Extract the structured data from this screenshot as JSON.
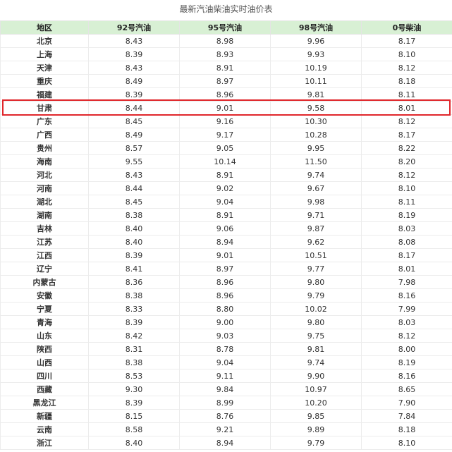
{
  "title": "最新汽油柴油实时油价表",
  "table": {
    "headers": [
      "地区",
      "92号汽油",
      "95号汽油",
      "98号汽油",
      "0号柴油"
    ],
    "highlighted_row": "甘肃",
    "rows": [
      [
        "北京",
        "8.43",
        "8.98",
        "9.96",
        "8.17"
      ],
      [
        "上海",
        "8.39",
        "8.93",
        "9.93",
        "8.10"
      ],
      [
        "天津",
        "8.43",
        "8.91",
        "10.19",
        "8.12"
      ],
      [
        "重庆",
        "8.49",
        "8.97",
        "10.11",
        "8.18"
      ],
      [
        "福建",
        "8.39",
        "8.96",
        "9.81",
        "8.11"
      ],
      [
        "甘肃",
        "8.44",
        "9.01",
        "9.58",
        "8.01"
      ],
      [
        "广东",
        "8.45",
        "9.16",
        "10.30",
        "8.12"
      ],
      [
        "广西",
        "8.49",
        "9.17",
        "10.28",
        "8.17"
      ],
      [
        "贵州",
        "8.57",
        "9.05",
        "9.95",
        "8.22"
      ],
      [
        "海南",
        "9.55",
        "10.14",
        "11.50",
        "8.20"
      ],
      [
        "河北",
        "8.43",
        "8.91",
        "9.74",
        "8.12"
      ],
      [
        "河南",
        "8.44",
        "9.02",
        "9.67",
        "8.10"
      ],
      [
        "湖北",
        "8.45",
        "9.04",
        "9.98",
        "8.11"
      ],
      [
        "湖南",
        "8.38",
        "8.91",
        "9.71",
        "8.19"
      ],
      [
        "吉林",
        "8.40",
        "9.06",
        "9.87",
        "8.03"
      ],
      [
        "江苏",
        "8.40",
        "8.94",
        "9.62",
        "8.08"
      ],
      [
        "江西",
        "8.39",
        "9.01",
        "10.51",
        "8.17"
      ],
      [
        "辽宁",
        "8.41",
        "8.97",
        "9.77",
        "8.01"
      ],
      [
        "内蒙古",
        "8.36",
        "8.96",
        "9.80",
        "7.98"
      ],
      [
        "安徽",
        "8.38",
        "8.96",
        "9.79",
        "8.16"
      ],
      [
        "宁夏",
        "8.33",
        "8.80",
        "10.02",
        "7.99"
      ],
      [
        "青海",
        "8.39",
        "9.00",
        "9.80",
        "8.03"
      ],
      [
        "山东",
        "8.42",
        "9.03",
        "9.75",
        "8.12"
      ],
      [
        "陕西",
        "8.31",
        "8.78",
        "9.81",
        "8.00"
      ],
      [
        "山西",
        "8.38",
        "9.04",
        "9.74",
        "8.19"
      ],
      [
        "四川",
        "8.53",
        "9.11",
        "9.90",
        "8.16"
      ],
      [
        "西藏",
        "9.30",
        "9.84",
        "10.97",
        "8.65"
      ],
      [
        "黑龙江",
        "8.39",
        "8.99",
        "10.20",
        "7.90"
      ],
      [
        "新疆",
        "8.15",
        "8.76",
        "9.85",
        "7.84"
      ],
      [
        "云南",
        "8.58",
        "9.21",
        "9.89",
        "8.18"
      ],
      [
        "浙江",
        "8.40",
        "8.94",
        "9.79",
        "8.10"
      ]
    ]
  },
  "colors": {
    "header_bg": "#d8f0d4",
    "highlight_border": "#e0262b"
  }
}
